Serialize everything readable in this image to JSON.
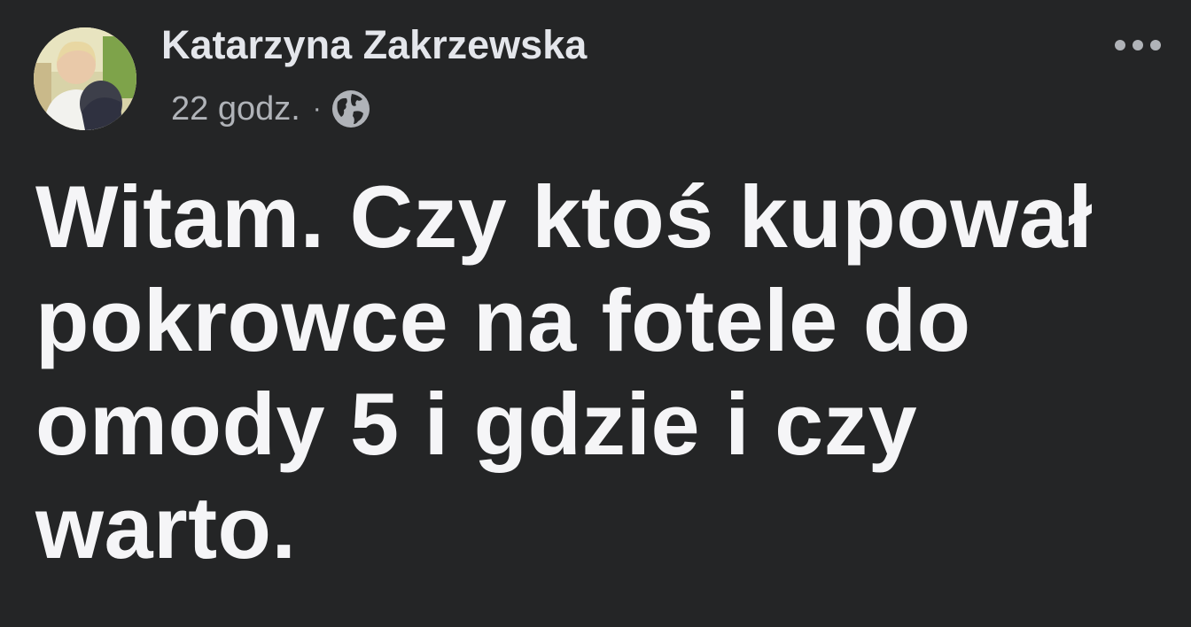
{
  "post": {
    "author": "Katarzyna Zakrzewska",
    "timestamp": "22 godz.",
    "separator": "·",
    "privacy_icon": "globe-icon",
    "more_icon": "more-options-icon",
    "text": "Witam. Czy ktoś kupował pokrowce na fotele do omody 5 i gdzie i czy warto."
  },
  "colors": {
    "background": "#242526",
    "author": "#e4e6eb",
    "meta": "#b0b3b8",
    "text": "#f5f5f7"
  }
}
